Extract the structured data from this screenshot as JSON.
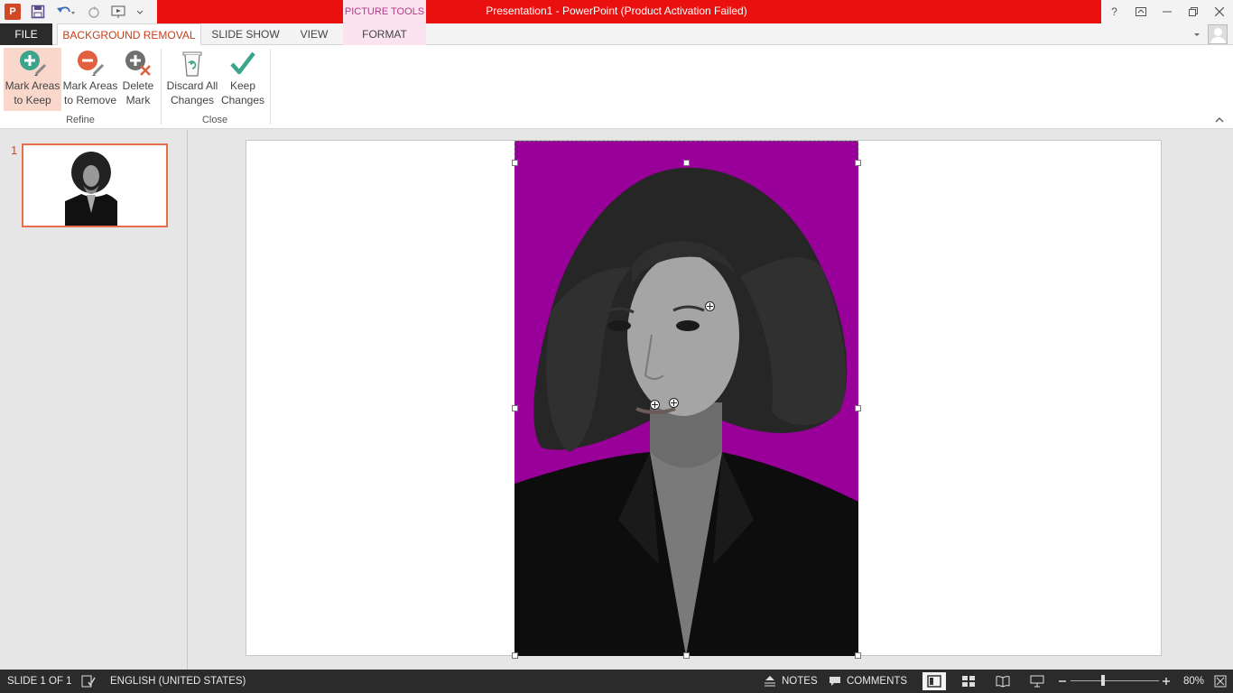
{
  "titlebar": {
    "title": "Presentation1  -  PowerPoint (Product Activation Failed)",
    "context_tab_group": "PICTURE TOOLS",
    "help": "?",
    "colors": {
      "titlebar_bg": "#ea1010",
      "context_bg": "#fbe4f0",
      "accent": "#d24726"
    }
  },
  "tabs": {
    "file": "FILE",
    "background_removal": "BACKGROUND REMOVAL",
    "slide_show": "SLIDE SHOW",
    "view": "VIEW",
    "format": "FORMAT"
  },
  "ribbon": {
    "refine": {
      "label": "Refine",
      "mark_keep": [
        "Mark Areas",
        "to Keep"
      ],
      "mark_remove": [
        "Mark Areas",
        "to Remove"
      ],
      "delete_mark": [
        "Delete",
        "Mark"
      ]
    },
    "close": {
      "label": "Close",
      "discard": [
        "Discard All",
        "Changes"
      ],
      "keep": [
        "Keep",
        "Changes"
      ]
    }
  },
  "thumbnails": {
    "slide_number": "1"
  },
  "status": {
    "slide": "SLIDE 1 OF 1",
    "language": "ENGLISH (UNITED STATES)",
    "notes": "NOTES",
    "comments": "COMMENTS",
    "zoom": "80%",
    "zoom_fraction": 0.4
  }
}
